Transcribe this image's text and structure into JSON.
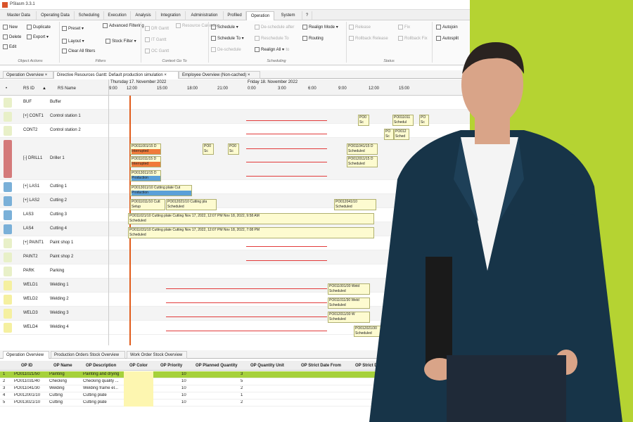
{
  "colors": {
    "lime": "#b5d332",
    "accent_orange": "#e05b1a",
    "gantt_bar": "#fdfbd0",
    "selected_row": "#a6d13b"
  },
  "app": {
    "title": "PSlasm 3.3.1"
  },
  "menu": {
    "tabs": [
      "Master Data",
      "Operating Data",
      "Scheduling",
      "Execution",
      "Analysis",
      "Integration",
      "Administration",
      "Profiled",
      "Operation",
      "System",
      "?"
    ],
    "active": "Operation"
  },
  "ribbon": {
    "object_actions": {
      "new": "New",
      "duplicate": "Duplicate",
      "delete": "Delete",
      "export": "Export",
      "edit": "Edit",
      "label": "Object Actions"
    },
    "filters": {
      "preset": "Preset",
      "advanced_filtering": "Advanced Filtering",
      "layout": "Layout",
      "stock_filter": "Stock Filter",
      "clear_all_filters": "Clear All filters",
      "label": "Filters"
    },
    "context": {
      "dr_gantt": "DR Gantt",
      "resource_calendar": "Resource Calendar",
      "it_gantt": "IT Gantt",
      "oc_gantt": "OC Gantt",
      "label": "Context Go To"
    },
    "scheduling": {
      "schedule": "Schedule",
      "schedule_to": "Schedule To",
      "de_schedule": "De-schedule",
      "de_schedule_after": "De-schedule after",
      "reschedule_to": "Reschedule To",
      "de_schedule_to": "De-schedule to",
      "realign_mode": "Realign Mode",
      "routing": "Routing",
      "realign_all": "Realign All",
      "label": "Scheduling"
    },
    "status": {
      "release": "Release",
      "rollback_release": "Rollback Release",
      "fix": "Fix",
      "rollback_fix": "Rollback Fix",
      "label": "Status"
    },
    "extra": {
      "autojoin": "Autojoin",
      "autosplit": "Autosplit"
    }
  },
  "doc_tabs": [
    "Operation Overview",
    "Directive Resources Gantt: Default production simulation",
    "Employee Overview (Non-cached)"
  ],
  "grid": {
    "col_rs_id": "RS ID",
    "col_rs_name": "RS Name",
    "day1": "Thursday 17. November 2022",
    "day2": "Friday 18. November 2022",
    "times": [
      "9:00",
      "12:00",
      "15:00",
      "18:00",
      "21:00",
      "0:00",
      "3:00",
      "6:00",
      "9:00",
      "12:00",
      "15:00"
    ]
  },
  "resources": [
    {
      "id": "BUF",
      "name": "Buffer",
      "color": "#e8f0c8"
    },
    {
      "id": "[+] CONT1",
      "name": "Control station 1",
      "color": "#e8f0c8"
    },
    {
      "id": "CONT2",
      "name": "Control station 2",
      "color": "#e8f0c8"
    },
    {
      "id": "[-] DRILL1",
      "name": "Driller 1",
      "color": "#d47a7a"
    },
    {
      "id": "[+] LAS1",
      "name": "Cutting 1",
      "color": "#7ab0d8"
    },
    {
      "id": "[+] LAS2",
      "name": "Cutting 2",
      "color": "#7ab0d8"
    },
    {
      "id": "LAS3",
      "name": "Cutting 3",
      "color": "#7ab0d8"
    },
    {
      "id": "LAS4",
      "name": "Cutting 4",
      "color": "#7ab0d8"
    },
    {
      "id": "[+] PAINT1",
      "name": "Paint shop 1",
      "color": "#e8f0c8"
    },
    {
      "id": "PAINT2",
      "name": "Paint shop 2",
      "color": "#e8f0c8"
    },
    {
      "id": "PARK",
      "name": "Parking",
      "color": "#e8f0c8"
    },
    {
      "id": "WELD1",
      "name": "Welding 1",
      "color": "#f5f0a0"
    },
    {
      "id": "WELD2",
      "name": "Welding 2",
      "color": "#f5f0a0"
    },
    {
      "id": "WELD3",
      "name": "Welding 3",
      "color": "#f5f0a0"
    },
    {
      "id": "WELD4",
      "name": "Welding 4",
      "color": "#f5f0a0"
    }
  ],
  "gantt_bars": {
    "b1": {
      "t": "PO0",
      "s": "Sc"
    },
    "b2": {
      "t": "PO011011",
      "s": "Schedul"
    },
    "b3": {
      "t": "PO",
      "s": "Sc"
    },
    "b4": {
      "t": "PO",
      "s": "Sc"
    },
    "b5": {
      "t": "PO012",
      "s": "Sched"
    },
    "b6": {
      "t": "PO011001/15 D",
      "s": "Interrupted"
    },
    "b7": {
      "t": "PO0",
      "s": "Sc"
    },
    "b8": {
      "t": "PO0",
      "s": "Sc"
    },
    "b9": {
      "t": "PO011041/15 D",
      "s": "Scheduled"
    },
    "b10": {
      "t": "PO011011/15 D",
      "s": "Interrupted"
    },
    "b11": {
      "t": "PO012011/15 D",
      "s": "Scheduled"
    },
    "b12": {
      "t": "PO013011/15 D",
      "s": "Production"
    },
    "b13": {
      "t": "PO013011/10 Cutting plate Cut",
      "s": "Production"
    },
    "b14": {
      "t": "PO011011/10 Cutt",
      "s": "Setup"
    },
    "b15": {
      "t": "PO012021/10 Cutting pla",
      "s": "Scheduled"
    },
    "b16": {
      "t": "PO012041/10",
      "s": "Scheduled"
    },
    "b17": {
      "t": "PO011021/10 Cutting plate Cutting Nov 17, 2022, 12:07 PM Nov 18, 2022, 9:58 AM",
      "s": "Scheduled"
    },
    "b18": {
      "t": "PO011031/10 Cutting plate Cutting Nov 17, 2022, 12:07 PM Nov 18, 2022, 7:08 PM",
      "s": "Scheduled"
    },
    "b19": {
      "t": "PO011001/30 Weld",
      "s": "Scheduled"
    },
    "b20": {
      "t": "PO011011/30 Weld",
      "s": "Scheduled"
    },
    "b21": {
      "t": "PO012011/30 W",
      "s": "Scheduled"
    },
    "b22": {
      "t": "PO012021/30",
      "s": "Scheduled"
    }
  },
  "bottom_tabs": [
    "Operation Overview",
    "Production Orders Stock Overview",
    "Work Order Stock Overview"
  ],
  "table": {
    "headers": [
      "OP ID",
      "OP Name",
      "OP Description",
      "OP Color",
      "OP Priority",
      "OP Planned Quantity",
      "OP Quantity Unit",
      "OP Strict Date From",
      "OP Strict Date T"
    ],
    "rows": [
      {
        "n": "1",
        "id": "PO011021/50",
        "name": "Painting",
        "desc": "Painting and drying",
        "prio": "10",
        "qty": "3"
      },
      {
        "n": "2",
        "id": "PO011031/40",
        "name": "Checking",
        "desc": "Checking quality ...",
        "prio": "10",
        "qty": "5"
      },
      {
        "n": "3",
        "id": "PO011041/30",
        "name": "Welding",
        "desc": "Welding frame el...",
        "prio": "10",
        "qty": "2"
      },
      {
        "n": "4",
        "id": "PO012001/10",
        "name": "Cutting",
        "desc": "Cutting plate",
        "prio": "10",
        "qty": "1"
      },
      {
        "n": "5",
        "id": "PO013021/10",
        "name": "Cutting",
        "desc": "Cutting plate",
        "prio": "10",
        "qty": "2"
      }
    ]
  }
}
